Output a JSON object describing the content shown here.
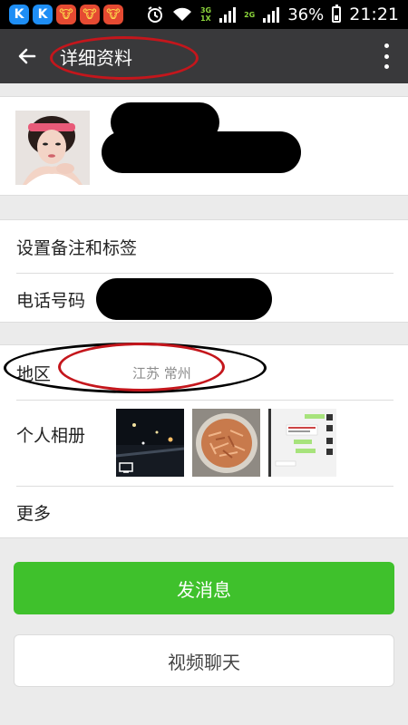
{
  "status_bar": {
    "time": "21:21",
    "battery_percent": "36%",
    "battery_level": 0.36,
    "network_top": "3G",
    "network_bottom": "1X",
    "network_alt": "2G",
    "icons": [
      "kugou-icon",
      "kugou-icon",
      "game-icon",
      "game-icon",
      "game-icon",
      "alarm-icon",
      "wifi-icon",
      "signal-icon",
      "battery-icon"
    ]
  },
  "appbar": {
    "title": "详细资料",
    "back_icon": "arrow-left-icon",
    "menu_icon": "more-vert-icon",
    "background": "#39393b"
  },
  "profile": {
    "avatar": "profile-photo"
  },
  "rows": {
    "remark_label": "设置备注和标签",
    "phone_label": "电话号码",
    "region_label": "地区",
    "region_value": "江苏  常州",
    "album_label": "个人相册",
    "more_label": "更多"
  },
  "album": {
    "photos": [
      "night-street-photo",
      "food-photo",
      "chat-screenshot-photo"
    ]
  },
  "buttons": {
    "send_label": "发消息",
    "video_label": "视频聊天",
    "send_color": "#3fc12c"
  },
  "annotations": {
    "circle_color": "#c4161c"
  }
}
